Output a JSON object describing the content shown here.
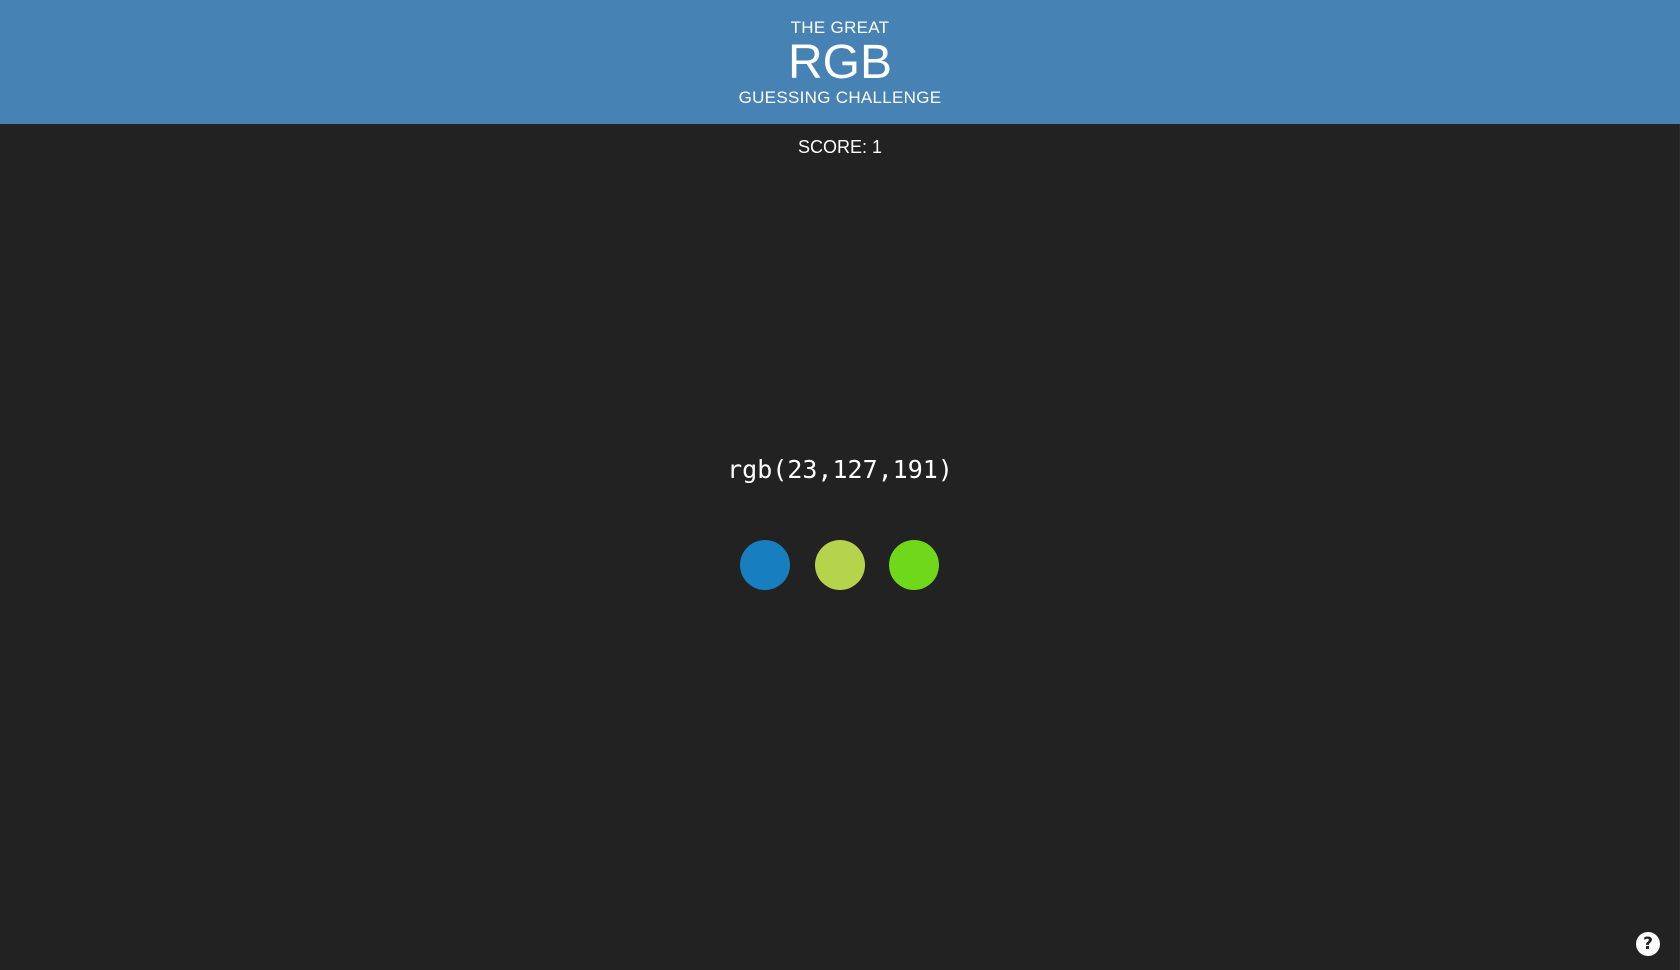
{
  "header": {
    "kicker": "THE GREAT",
    "title": "RGB",
    "subtitle": "GUESSING CHALLENGE",
    "background_color": "#4682b4"
  },
  "score": {
    "label": "SCORE: 1"
  },
  "challenge": {
    "rgb_text": "rgb(23,127,191)"
  },
  "options": [
    {
      "color": "#177fbf"
    },
    {
      "color": "#b6d44b"
    },
    {
      "color": "#6fd81a"
    }
  ],
  "help": {
    "icon": "question-circle-icon",
    "glyph": "?"
  },
  "colors": {
    "background": "#222222",
    "text": "#ffffff"
  }
}
